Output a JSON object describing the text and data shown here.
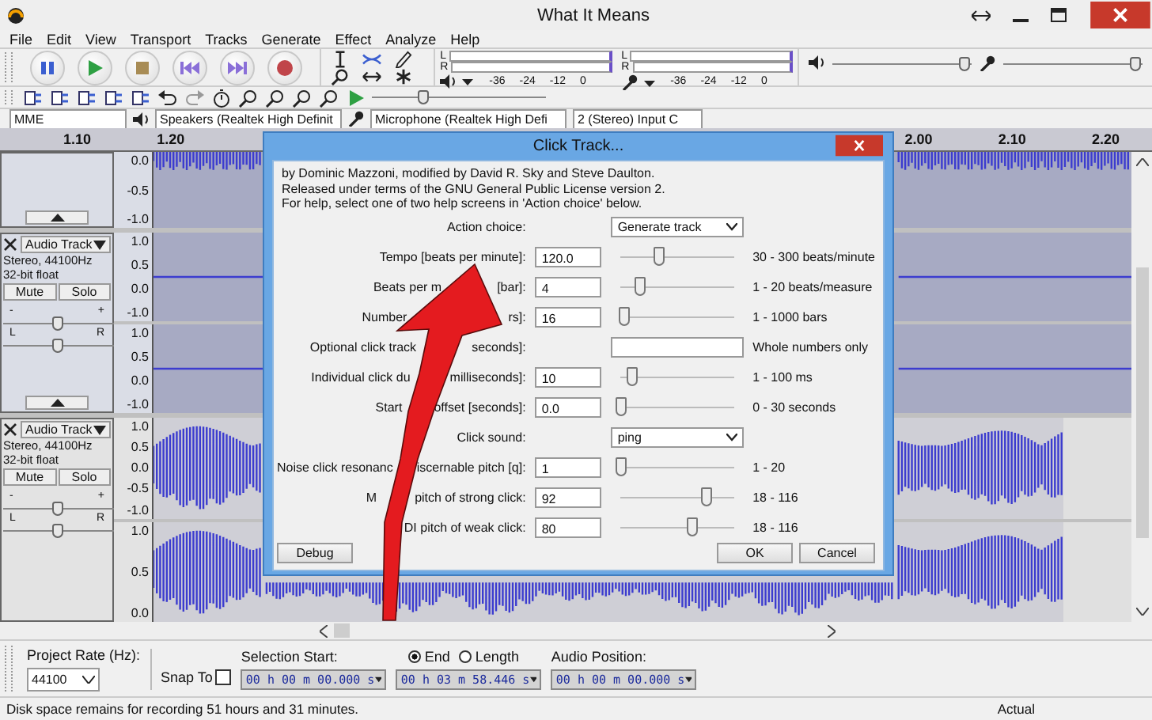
{
  "window": {
    "title": "What It Means"
  },
  "menu": [
    "File",
    "Edit",
    "View",
    "Transport",
    "Tracks",
    "Generate",
    "Effect",
    "Analyze",
    "Help"
  ],
  "playback_meter": {
    "channels": [
      "L",
      "R"
    ],
    "scale": [
      "-36",
      "-24",
      "-12",
      "0"
    ]
  },
  "recording_meter": {
    "channels": [
      "L",
      "R"
    ],
    "scale": [
      "-36",
      "-24",
      "-12",
      "0"
    ]
  },
  "mixer": {
    "playback": {
      "level": 0.95
    },
    "recording": {
      "level": 0.95
    }
  },
  "speed_slider": {
    "level": 0.3
  },
  "devices": {
    "host": "MME",
    "output": "Speakers (Realtek High Definit",
    "input": "Microphone (Realtek High Defi",
    "channels": "2 (Stereo) Input C"
  },
  "ruler": [
    "1.10",
    "1.20",
    "2.00",
    "2.10",
    "2.20"
  ],
  "tracks": [
    {
      "kind": "clipped",
      "channels": [
        {
          "axis": [
            "0.0",
            "-0.5",
            "-1.0"
          ]
        }
      ]
    },
    {
      "kind": "quiet",
      "name": "Audio Track",
      "info": [
        "Stereo, 44100Hz",
        "32-bit float"
      ],
      "mute": "Mute",
      "solo": "Solo",
      "gain": {
        "min": "-",
        "max": "+",
        "level": 0.5
      },
      "pan": {
        "min": "L",
        "max": "R",
        "level": 0.5
      },
      "channels": [
        {
          "axis": [
            "1.0",
            "0.5",
            "0.0",
            "-1.0"
          ]
        },
        {
          "axis": [
            "1.0",
            "0.5",
            "0.0",
            "-1.0"
          ]
        }
      ]
    },
    {
      "kind": "loud",
      "name": "Audio Track",
      "info": [
        "Stereo, 44100Hz",
        "32-bit float"
      ],
      "mute": "Mute",
      "solo": "Solo",
      "gain": {
        "min": "-",
        "max": "+",
        "level": 0.5
      },
      "pan": {
        "min": "L",
        "max": "R",
        "level": 0.5
      },
      "channels": [
        {
          "axis": [
            "1.0",
            "0.5",
            "0.0",
            "-0.5",
            "-1.0"
          ]
        },
        {
          "axis": [
            "1.0",
            "0.5",
            "0.0"
          ]
        }
      ]
    }
  ],
  "dialog": {
    "title": "Click Track...",
    "intro": [
      "by Dominic Mazzoni, modified by David R. Sky and Steve Daulton.",
      "Released under terms of the GNU General Public License version 2.",
      "For help, select one of two help screens in 'Action choice' below."
    ],
    "rows": [
      {
        "kind": "choice",
        "label": [
          "Action choice:"
        ],
        "value": "Generate track"
      },
      {
        "kind": "slider",
        "label": [
          "Tempo [beats per minute]:"
        ],
        "value": "120.0",
        "level": 0.33,
        "range": "30 - 300 beats/minute"
      },
      {
        "kind": "slider",
        "label": [
          "Beats per m",
          "[bar]:"
        ],
        "value": "4",
        "level": 0.16,
        "range": "1 - 20 beats/measure"
      },
      {
        "kind": "slider",
        "label": [
          "Number",
          "rs]:"
        ],
        "value": "16",
        "level": 0.02,
        "range": "1 - 1000 bars"
      },
      {
        "kind": "text",
        "label": [
          "Optional click track",
          "seconds]:"
        ],
        "value": "",
        "hint": "Whole numbers only"
      },
      {
        "kind": "slider",
        "label": [
          "Individual click du",
          "milliseconds]:"
        ],
        "value": "10",
        "level": 0.09,
        "range": "1 - 100 ms"
      },
      {
        "kind": "slider",
        "label": [
          "Start",
          "offset [seconds]:"
        ],
        "value": "0.0",
        "level": 0,
        "range": "0 - 30 seconds"
      },
      {
        "kind": "choice",
        "label": [
          "Click sound:"
        ],
        "value": "ping"
      },
      {
        "kind": "slider",
        "label": [
          "Noise click resonanc",
          "iscernable pitch [q]:"
        ],
        "value": "1",
        "level": 0,
        "range": "1 - 20"
      },
      {
        "kind": "slider",
        "label": [
          "M",
          "pitch of strong click:"
        ],
        "value": "92",
        "level": 0.75,
        "range": "18 - 116"
      },
      {
        "kind": "slider",
        "label": [
          "DI pitch of weak click:"
        ],
        "value": "80",
        "level": 0.63,
        "range": "18 - 116"
      }
    ],
    "buttons": {
      "debug": "Debug",
      "ok": "OK",
      "cancel": "Cancel"
    }
  },
  "selection_toolbar": {
    "rate_label": "Project Rate (Hz):",
    "rate": "44100",
    "snap_label": "Snap To",
    "snap_checked": false,
    "start_label": "Selection Start:",
    "modes": [
      {
        "label": "End",
        "selected": true
      },
      {
        "label": "Length",
        "selected": false
      }
    ],
    "start": "00 h 00 m 00.000 s",
    "end": "00 h 03 m 58.446 s",
    "position_label": "Audio Position:",
    "position": "00 h 00 m 00.000 s"
  },
  "status_bar": {
    "message": "Disk space remains for recording 51 hours and 31 minutes.",
    "rate": "Actual"
  }
}
